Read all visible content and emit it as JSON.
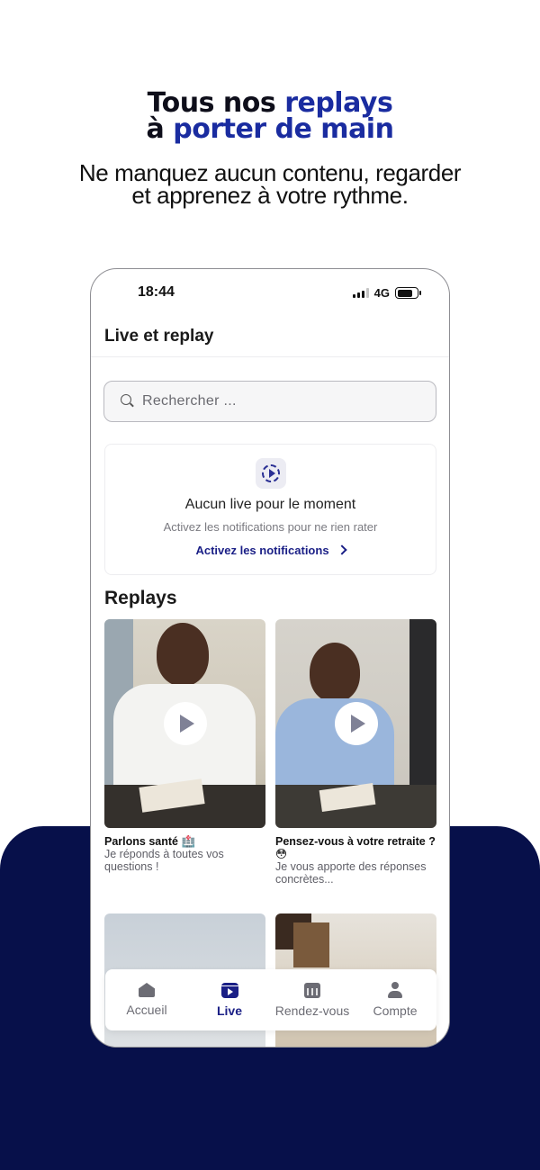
{
  "hero": {
    "title_part1": "Tous nos ",
    "title_accent1": "replays",
    "title_part2": "à ",
    "title_accent2": "porter de main",
    "subtitle_line1": "Ne manquez aucun contenu, regarder",
    "subtitle_line2": "et apprenez à votre rythme."
  },
  "colors": {
    "accent": "#1a2ca0",
    "navy_background": "#07104a",
    "link": "#1a1f86"
  },
  "status_bar": {
    "time": "18:44",
    "network": "4G"
  },
  "header": {
    "title": "Live et replay"
  },
  "search": {
    "placeholder": "Rechercher ..."
  },
  "live_card": {
    "icon": "live-play-icon",
    "title": "Aucun live pour le moment",
    "subtitle": "Activez les notifications pour ne rien rater",
    "link_label": "Activez les notifications"
  },
  "replays": {
    "title": "Replays",
    "videos": [
      {
        "title": "Parlons santé 🏥",
        "description": "Je réponds à toutes vos questions !"
      },
      {
        "title": "Pensez-vous à votre retraite ? 😳",
        "description": "Je vous apporte des réponses concrètes..."
      }
    ]
  },
  "tab_bar": {
    "items": [
      {
        "label": "Accueil",
        "icon": "home-icon",
        "active": false
      },
      {
        "label": "Live",
        "icon": "live-icon",
        "active": true
      },
      {
        "label": "Rendez-vous",
        "icon": "calendar-icon",
        "active": false
      },
      {
        "label": "Compte",
        "icon": "user-icon",
        "active": false
      }
    ]
  }
}
